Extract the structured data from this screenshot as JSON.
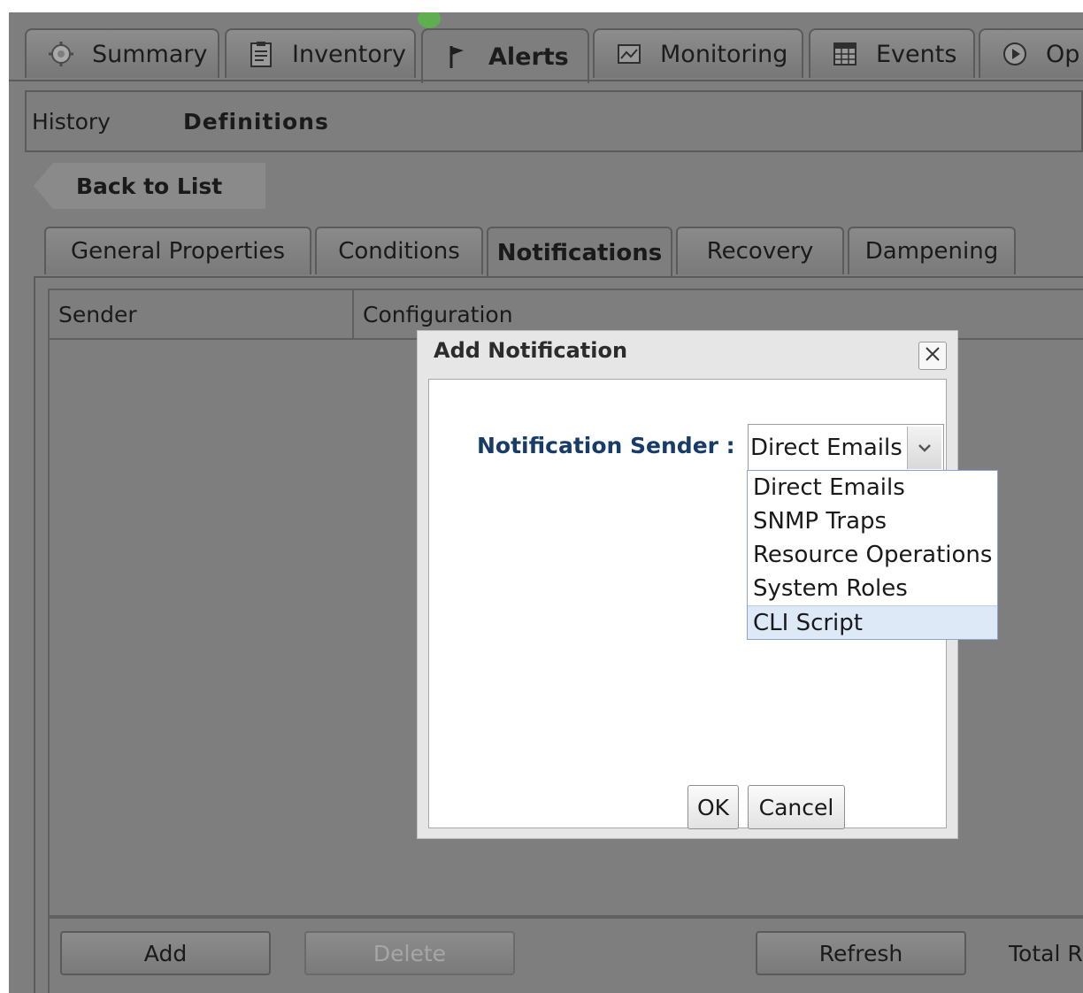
{
  "top_tabs": [
    {
      "label": "Summary",
      "icon": "gear-icon"
    },
    {
      "label": "Inventory",
      "icon": "clipboard-icon"
    },
    {
      "label": "Alerts",
      "icon": "flag-icon",
      "active": true
    },
    {
      "label": "Monitoring",
      "icon": "monitor-icon"
    },
    {
      "label": "Events",
      "icon": "calendar-grid-icon"
    },
    {
      "label": "Op",
      "icon": "play-circle-icon"
    }
  ],
  "subnav": {
    "history": "History",
    "definitions": "Definitions"
  },
  "back_button": "Back to List",
  "sub_tabs": [
    {
      "label": "General Properties"
    },
    {
      "label": "Conditions"
    },
    {
      "label": "Notifications",
      "active": true
    },
    {
      "label": "Recovery"
    },
    {
      "label": "Dampening"
    }
  ],
  "grid": {
    "columns": [
      "Sender",
      "Configuration"
    ]
  },
  "footer": {
    "add": "Add",
    "delete": "Delete",
    "refresh": "Refresh",
    "total": "Total R"
  },
  "dialog": {
    "title": "Add Notification",
    "field_label": "Notification Sender :",
    "selected": "Direct Emails",
    "options": [
      "Direct Emails",
      "SNMP Traps",
      "Resource Operations",
      "System Roles",
      "CLI Script"
    ],
    "highlighted_option": "CLI Script",
    "ok": "OK",
    "cancel": "Cancel"
  },
  "colors": {
    "background": "#7e7e7e",
    "field_label": "#173c69",
    "highlight": "#dde9f6"
  }
}
